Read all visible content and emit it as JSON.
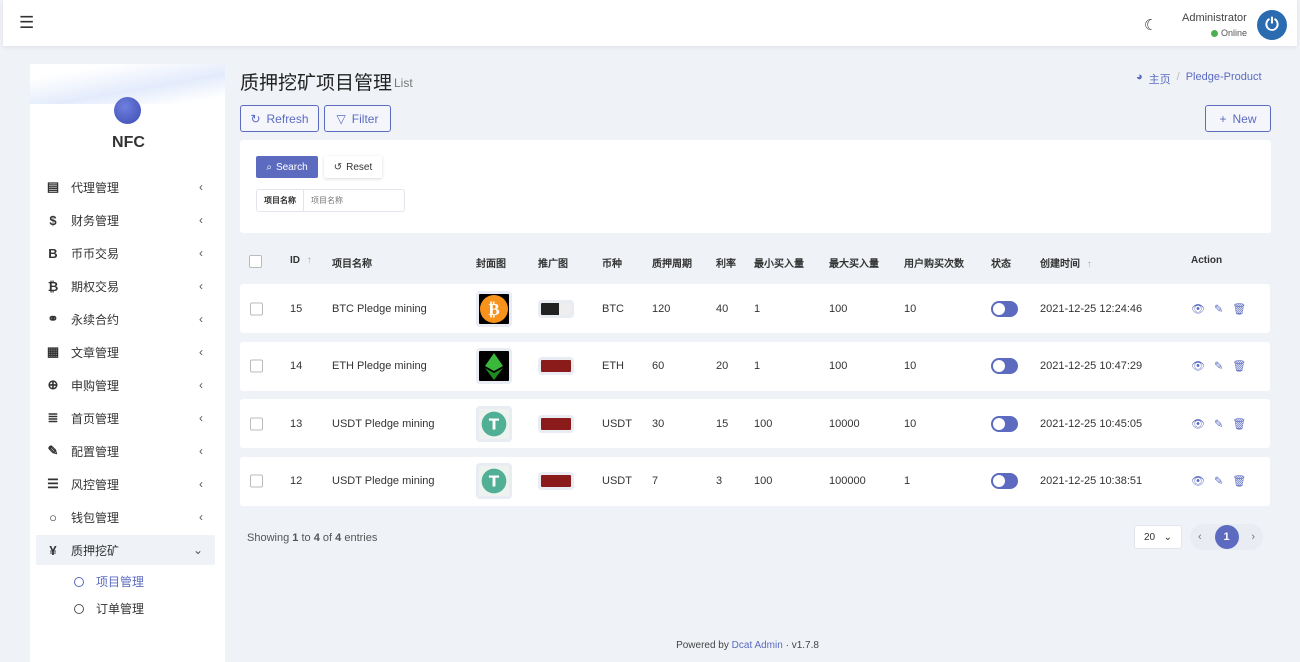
{
  "header": {
    "user": "Administrator",
    "status": "Online"
  },
  "sidebar": {
    "brand": "NFC",
    "items": [
      {
        "icon": "id-card-icon",
        "glyph": "▤",
        "label": "代理管理"
      },
      {
        "icon": "dollar-icon",
        "glyph": "$",
        "label": "财务管理"
      },
      {
        "icon": "bitcoin-b-icon",
        "glyph": "B",
        "label": "币币交易"
      },
      {
        "icon": "bitcoin-icon",
        "glyph": "₿",
        "label": "期权交易"
      },
      {
        "icon": "link-icon",
        "glyph": "⚭",
        "label": "永续合约"
      },
      {
        "icon": "newspaper-icon",
        "glyph": "▦",
        "label": "文章管理"
      },
      {
        "icon": "support-icon",
        "glyph": "⊕",
        "label": "申购管理"
      },
      {
        "icon": "list-icon",
        "glyph": "≣",
        "label": "首页管理"
      },
      {
        "icon": "wrench-icon",
        "glyph": "✎",
        "label": "配置管理"
      },
      {
        "icon": "list-indent-icon",
        "glyph": "☰",
        "label": "风控管理"
      },
      {
        "icon": "circle-icon",
        "glyph": "○",
        "label": "钱包管理"
      },
      {
        "icon": "yen-icon",
        "glyph": "¥",
        "label": "质押挖矿"
      }
    ],
    "subitems": [
      {
        "label": "项目管理",
        "active": true
      },
      {
        "label": "订单管理",
        "active": false
      }
    ]
  },
  "page": {
    "title": "质押挖矿项目管理",
    "subtitle": "List",
    "breadcrumb_home": "主页",
    "breadcrumb_current": "Pledge-Product"
  },
  "toolbar": {
    "refresh": "Refresh",
    "filter": "Filter",
    "new": "New"
  },
  "filter": {
    "search": "Search",
    "reset": "Reset",
    "field_label": "项目名称",
    "field_placeholder": "项目名称"
  },
  "table": {
    "headers": [
      "ID",
      "项目名称",
      "封面图",
      "推广图",
      "币种",
      "质押周期",
      "利率",
      "最小买入量",
      "最大买入量",
      "用户购买次数",
      "状态",
      "创建时间",
      "Action"
    ],
    "rows": [
      {
        "id": "15",
        "name": "BTC Pledge mining",
        "coin": "BTC",
        "period": "120",
        "rate": "40",
        "min": "1",
        "max": "100",
        "count": "10",
        "status": true,
        "created": "2021-12-25 12:24:46",
        "cover": "bitcoin"
      },
      {
        "id": "14",
        "name": "ETH Pledge mining",
        "coin": "ETH",
        "period": "60",
        "rate": "20",
        "min": "1",
        "max": "100",
        "count": "10",
        "status": true,
        "created": "2021-12-25 10:47:29",
        "cover": "ethereum"
      },
      {
        "id": "13",
        "name": "USDT Pledge mining",
        "coin": "USDT",
        "period": "30",
        "rate": "15",
        "min": "100",
        "max": "10000",
        "count": "10",
        "status": true,
        "created": "2021-12-25 10:45:05",
        "cover": "tether"
      },
      {
        "id": "12",
        "name": "USDT Pledge mining",
        "coin": "USDT",
        "period": "7",
        "rate": "3",
        "min": "100",
        "max": "100000",
        "count": "1",
        "status": true,
        "created": "2021-12-25 10:38:51",
        "cover": "tether"
      }
    ]
  },
  "pagination": {
    "showing": "Showing",
    "from": "1",
    "to_word": "to",
    "to": "4",
    "of_word": "of",
    "total": "4",
    "entries": "entries",
    "per_page": "20",
    "current": "1"
  },
  "footer": {
    "powered": "Powered by",
    "link": "Dcat Admin",
    "version": "v1.7.8"
  },
  "colors": {
    "accent": "#5c6bc0",
    "online": "#4caf50"
  }
}
